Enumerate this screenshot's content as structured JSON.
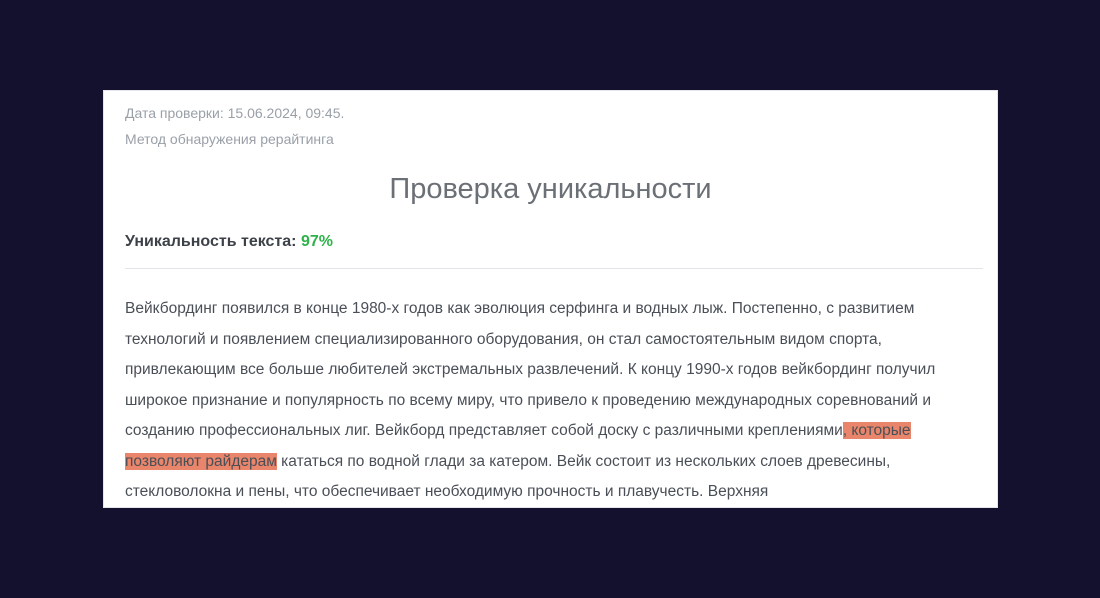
{
  "meta": {
    "check_date": "Дата проверки: 15.06.2024, 09:45.",
    "method": "Метод обнаружения рерайтинга"
  },
  "title": "Проверка уникальности",
  "uniqueness": {
    "label": "Уникальность текста:",
    "value": "97%"
  },
  "colors": {
    "page_background": "#14112e",
    "uniqueness_value": "#2fb24a",
    "highlight": "#e8856a"
  },
  "text": {
    "before_highlight": "Вейкбординг появился в конце 1980-х годов как эволюция серфинга и водных лыж. Постепенно, с развитием технологий и появлением специализированного оборудования, он стал самостоятельным видом спорта, привлекающим все больше любителей экстремальных развлечений. К концу 1990-х годов вейкбординг получил широкое признание и популярность по всему миру, что привело к проведению международных соревнований и созданию профессиональных лиг. Вейкборд представляет собой доску с различными креплениями",
    "highlighted": ", которые позволяют райдерам",
    "after_highlight": " кататься по водной глади за катером. Вейк состоит из нескольких слоев древесины, стекловолокна и пены, что обеспечивает необходимую прочность и плавучесть. Верхняя"
  }
}
